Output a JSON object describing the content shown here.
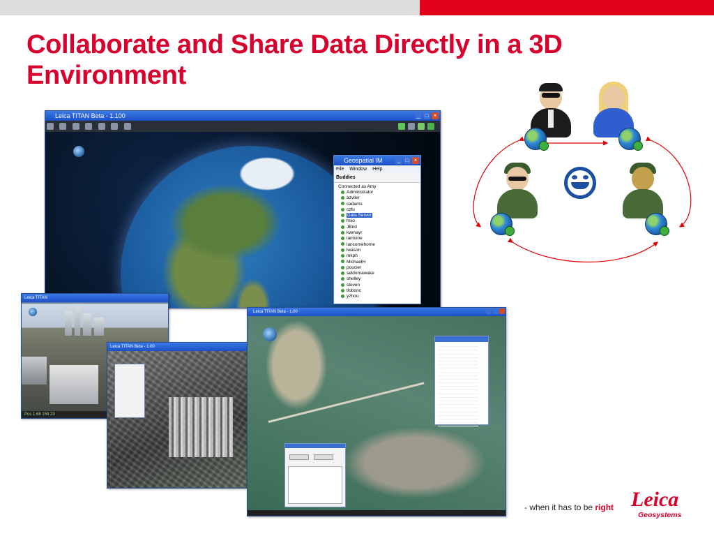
{
  "slide": {
    "title": "Collaborate and Share Data Directly in a 3D Environment",
    "tagline_prefix": "- when it has to be ",
    "tagline_emphasis": "right",
    "logo_word": "Leica",
    "logo_sub": "Geosystems"
  },
  "colors": {
    "brand_red": "#d8002c",
    "top_bar_gray": "#dcdcdc",
    "top_bar_red": "#e2001a",
    "diagram_arrow": "#e00000"
  },
  "main_window": {
    "title": "Leica TITAN Beta - 1.100"
  },
  "buddy_window": {
    "title": "Geospatial IM",
    "menu": [
      "File",
      "Window",
      "Help"
    ],
    "header": "Buddies",
    "connected_as": "Connected as Amy",
    "buddies": [
      "Administrator",
      "azviler",
      "cadams",
      "czfu",
      "Data Server",
      "hsio",
      "JBird",
      "kwmayr",
      "lantoine",
      "lancomehome",
      "lwason",
      "mkph",
      "MichaelH",
      "poucier",
      "seldomawake",
      "shelley",
      "steven",
      "tlobonc",
      "yzhou"
    ],
    "selected": "Data Server"
  },
  "city_window": {
    "title": "Leica TITAN",
    "status": "Pos 1 68 159 23"
  },
  "aerial_window": {
    "title": "Leica TITAN Beta - 1.00"
  },
  "miami_window": {
    "title": "Leica TITAN Beta - 1.00"
  },
  "diagram": {
    "people": [
      {
        "name": "agent-person",
        "icon": "agent-sunglasses-icon"
      },
      {
        "name": "operator-person",
        "icon": "headset-operator-icon"
      },
      {
        "name": "soldier-left",
        "icon": "soldier-icon"
      },
      {
        "name": "soldier-right",
        "icon": "soldier-camo-icon"
      }
    ],
    "center_logo": "napster-cat-icon"
  }
}
